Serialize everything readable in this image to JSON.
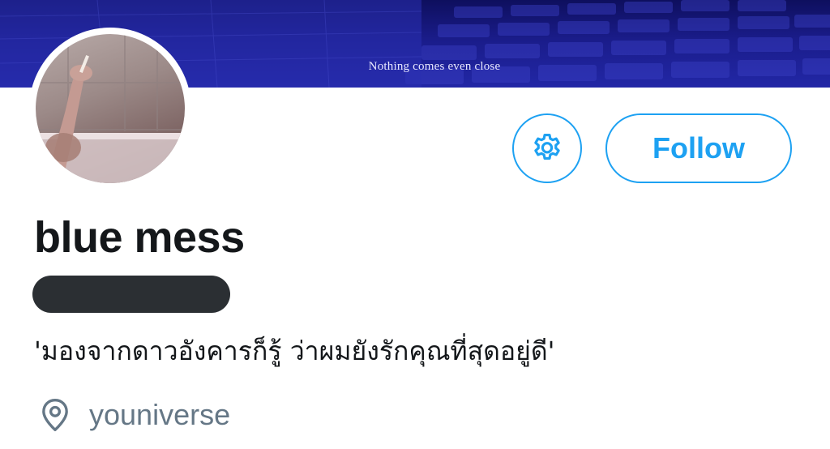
{
  "banner": {
    "caption": "Nothing comes even close"
  },
  "avatar": {
    "icon": "profile-photo"
  },
  "actions": {
    "settings_icon": "gear-icon",
    "follow_label": "Follow"
  },
  "profile": {
    "display_name": "blue mess",
    "bio": "'มองจากดาวอังคารก็รู้ ว่าผมยังรักคุณที่สุดอยู่ดี'",
    "location": "youniverse",
    "location_icon": "location-pin-icon"
  },
  "colors": {
    "accent": "#1da1f2",
    "text_primary": "#14171a",
    "text_secondary": "#657786",
    "banner": "#1a1c8a"
  }
}
